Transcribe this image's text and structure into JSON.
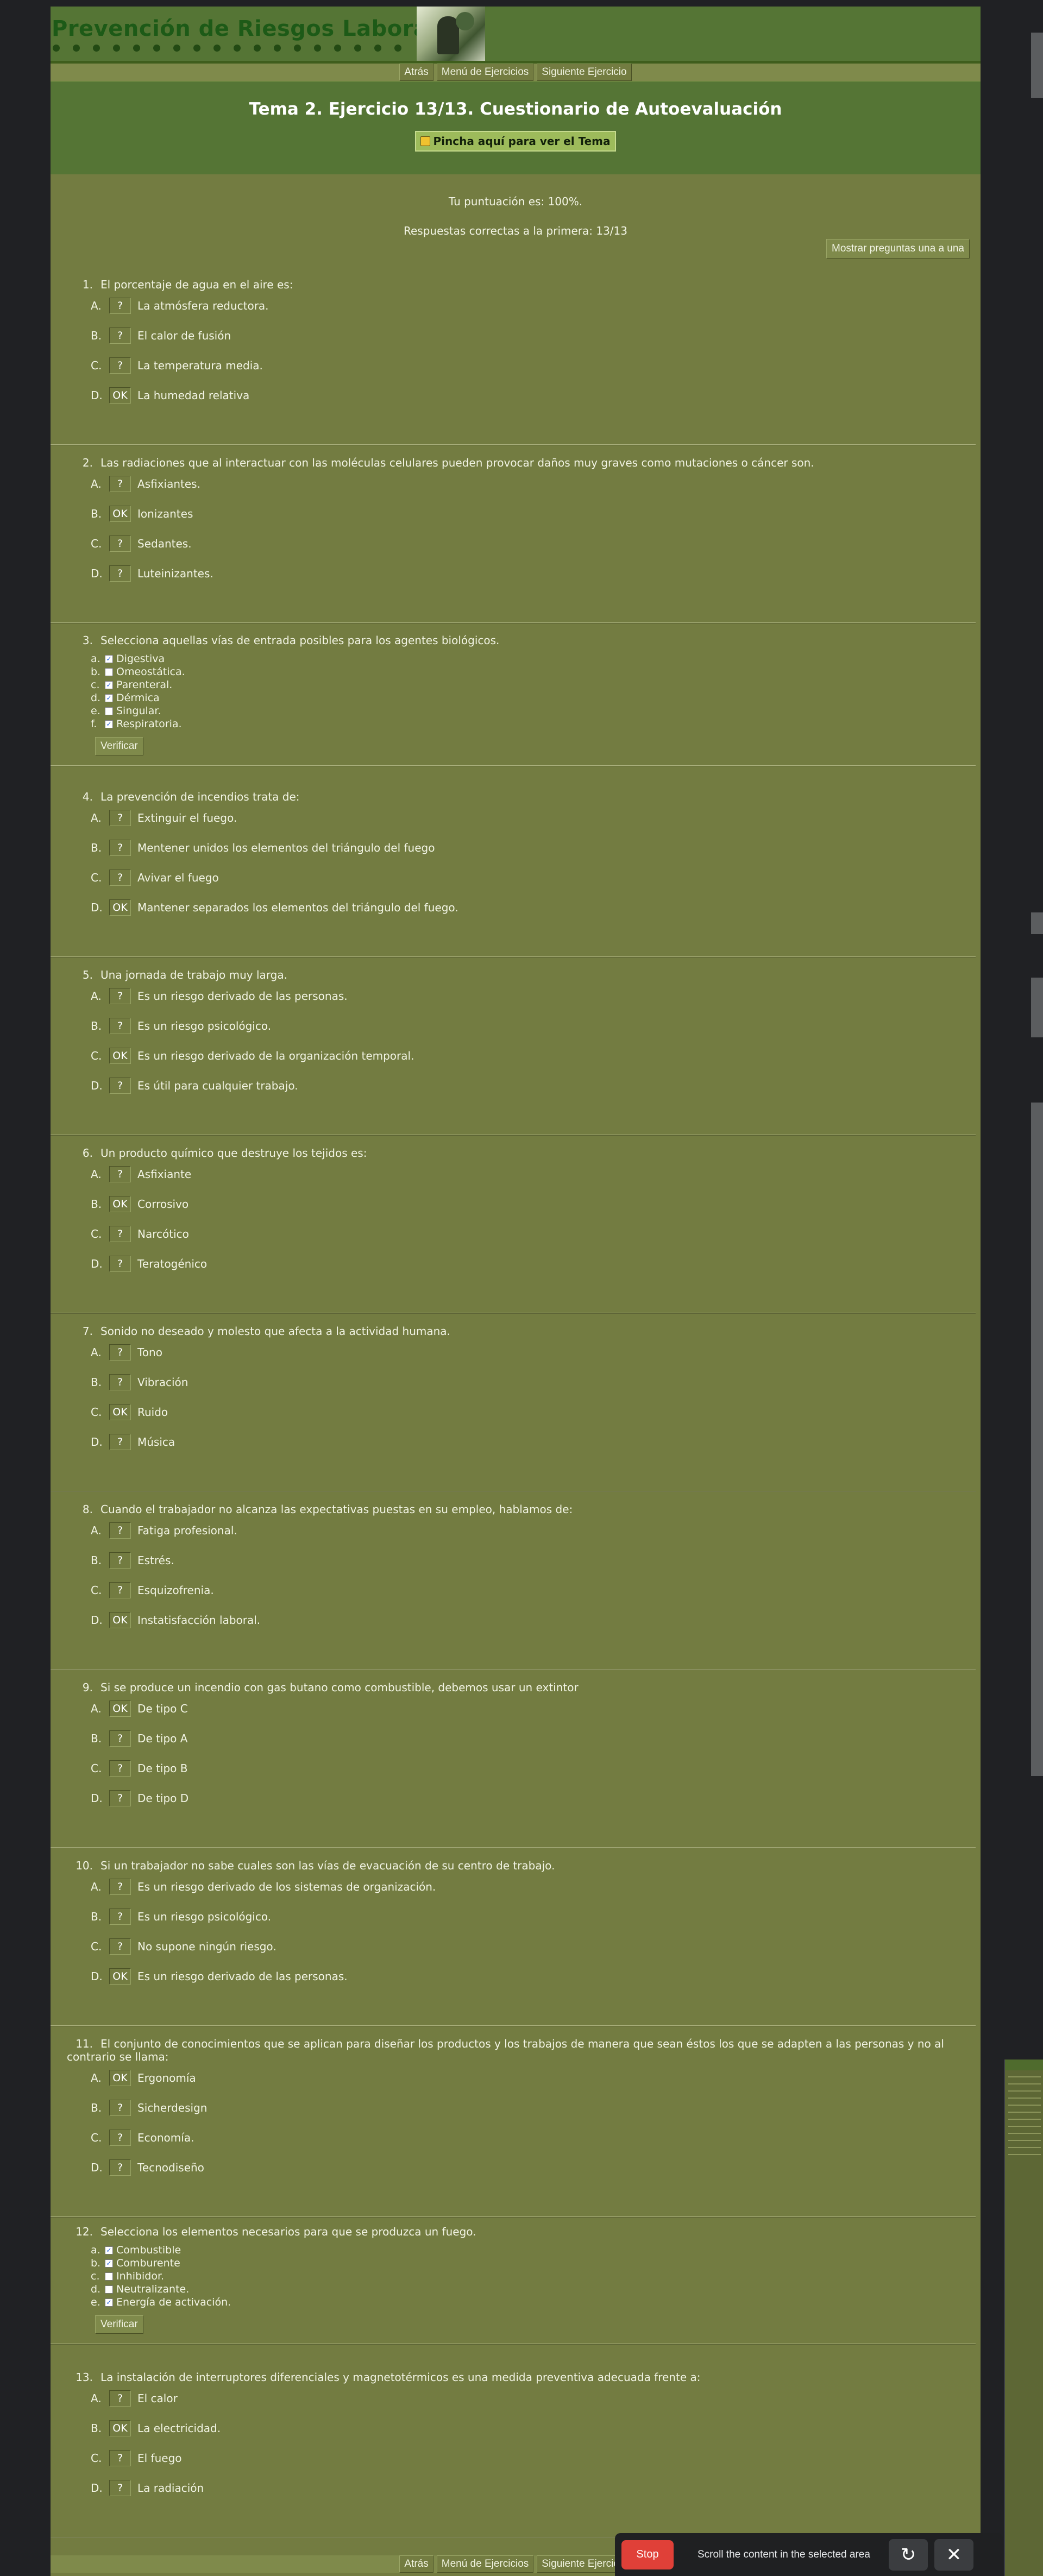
{
  "header": {
    "logo_text": "Prevención de Riesgos Laborales",
    "nav": [
      "Atrás",
      "Menú de Ejercicios",
      "Siguiente Ejercicio"
    ]
  },
  "exercise": {
    "title": "Tema 2. Ejercicio 13/13. Cuestionario de Autoevaluación",
    "theme_link": "Pincha aquí para ver el Tema",
    "score": "Tu puntuación es: 100%.",
    "first_try": "Respuestas correctas a la primera: 13/13",
    "show_one_button": "Mostrar preguntas una a una"
  },
  "questions": [
    {
      "num": "1.",
      "text": "El porcentaje de agua en el aire es:",
      "options": [
        {
          "letter": "A.",
          "mark": "?",
          "text": "La atmósfera reductora."
        },
        {
          "letter": "B.",
          "mark": "?",
          "text": "El calor de fusión"
        },
        {
          "letter": "C.",
          "mark": "?",
          "text": "La temperatura media."
        },
        {
          "letter": "D.",
          "mark": "OK",
          "text": "La humedad relativa"
        }
      ]
    },
    {
      "num": "2.",
      "text": "Las radiaciones que al interactuar con las moléculas celulares pueden provocar daños muy graves como mutaciones o cáncer son.",
      "options": [
        {
          "letter": "A.",
          "mark": "?",
          "text": "Asfixiantes."
        },
        {
          "letter": "B.",
          "mark": "OK",
          "text": "Ionizantes"
        },
        {
          "letter": "C.",
          "mark": "?",
          "text": "Sedantes."
        },
        {
          "letter": "D.",
          "mark": "?",
          "text": "Luteinizantes."
        }
      ]
    },
    {
      "num": "3.",
      "text": "Selecciona aquellas vías de entrada posibles para los agentes biológicos.",
      "checks": [
        {
          "letter": "a.",
          "checked": true,
          "text": "Digestiva"
        },
        {
          "letter": "b.",
          "checked": false,
          "text": "Omeostática."
        },
        {
          "letter": "c.",
          "checked": true,
          "text": "Parenteral."
        },
        {
          "letter": "d.",
          "checked": true,
          "text": "Dérmica"
        },
        {
          "letter": "e.",
          "checked": false,
          "text": "Singular."
        },
        {
          "letter": "f.",
          "checked": true,
          "text": "Respiratoria."
        }
      ],
      "verify": "Verificar"
    },
    {
      "num": "4.",
      "text": "La prevención de incendios trata de:",
      "options": [
        {
          "letter": "A.",
          "mark": "?",
          "text": "Extinguir el fuego."
        },
        {
          "letter": "B.",
          "mark": "?",
          "text": "Mentener unidos los elementos del triángulo del fuego"
        },
        {
          "letter": "C.",
          "mark": "?",
          "text": "Avivar el fuego"
        },
        {
          "letter": "D.",
          "mark": "OK",
          "text": "Mantener separados los elementos del triángulo del fuego."
        }
      ]
    },
    {
      "num": "5.",
      "text": "Una jornada de trabajo muy larga.",
      "options": [
        {
          "letter": "A.",
          "mark": "?",
          "text": "Es un riesgo derivado de las personas."
        },
        {
          "letter": "B.",
          "mark": "?",
          "text": "Es un riesgo psicológico."
        },
        {
          "letter": "C.",
          "mark": "OK",
          "text": "Es un riesgo derivado de la organización temporal."
        },
        {
          "letter": "D.",
          "mark": "?",
          "text": "Es útil para cualquier trabajo."
        }
      ]
    },
    {
      "num": "6.",
      "text": "Un producto químico que destruye los tejidos es:",
      "options": [
        {
          "letter": "A.",
          "mark": "?",
          "text": "Asfixiante"
        },
        {
          "letter": "B.",
          "mark": "OK",
          "text": "Corrosivo"
        },
        {
          "letter": "C.",
          "mark": "?",
          "text": "Narcótico"
        },
        {
          "letter": "D.",
          "mark": "?",
          "text": "Teratogénico"
        }
      ]
    },
    {
      "num": "7.",
      "text": "Sonido no deseado y molesto que afecta a la actividad humana.",
      "options": [
        {
          "letter": "A.",
          "mark": "?",
          "text": "Tono"
        },
        {
          "letter": "B.",
          "mark": "?",
          "text": "Vibración"
        },
        {
          "letter": "C.",
          "mark": "OK",
          "text": "Ruido"
        },
        {
          "letter": "D.",
          "mark": "?",
          "text": "Música"
        }
      ]
    },
    {
      "num": "8.",
      "text": "Cuando el trabajador no alcanza las expectativas puestas en su empleo, hablamos de:",
      "options": [
        {
          "letter": "A.",
          "mark": "?",
          "text": "Fatiga profesional."
        },
        {
          "letter": "B.",
          "mark": "?",
          "text": "Estrés."
        },
        {
          "letter": "C.",
          "mark": "?",
          "text": "Esquizofrenia."
        },
        {
          "letter": "D.",
          "mark": "OK",
          "text": "Instatisfacción laboral."
        }
      ]
    },
    {
      "num": "9.",
      "text": "Si se produce un incendio con gas butano como combustible, debemos usar un extintor",
      "options": [
        {
          "letter": "A.",
          "mark": "OK",
          "text": "De tipo C"
        },
        {
          "letter": "B.",
          "mark": "?",
          "text": "De tipo A"
        },
        {
          "letter": "C.",
          "mark": "?",
          "text": "De tipo B"
        },
        {
          "letter": "D.",
          "mark": "?",
          "text": "De tipo D"
        }
      ]
    },
    {
      "num": "10.",
      "text": "Si un trabajador no sabe cuales son las vías de evacuación de su centro de trabajo.",
      "options": [
        {
          "letter": "A.",
          "mark": "?",
          "text": "Es un riesgo derivado de los sistemas de organización."
        },
        {
          "letter": "B.",
          "mark": "?",
          "text": "Es un riesgo psicológico."
        },
        {
          "letter": "C.",
          "mark": "?",
          "text": "No supone ningún riesgo."
        },
        {
          "letter": "D.",
          "mark": "OK",
          "text": "Es un riesgo derivado de las personas."
        }
      ]
    },
    {
      "num": "11.",
      "text": "El conjunto de conocimientos que se aplican para diseñar los productos y los trabajos de manera que sean éstos los que se adapten a las personas y no al contrario se llama:",
      "options": [
        {
          "letter": "A.",
          "mark": "OK",
          "text": "Ergonomía"
        },
        {
          "letter": "B.",
          "mark": "?",
          "text": "Sicherdesign"
        },
        {
          "letter": "C.",
          "mark": "?",
          "text": "Economía."
        },
        {
          "letter": "D.",
          "mark": "?",
          "text": "Tecnodiseño"
        }
      ]
    },
    {
      "num": "12.",
      "text": "Selecciona los elementos necesarios para que se produzca un fuego.",
      "checks": [
        {
          "letter": "a.",
          "checked": true,
          "text": "Combustible"
        },
        {
          "letter": "b.",
          "checked": true,
          "text": "Comburente"
        },
        {
          "letter": "c.",
          "checked": false,
          "text": "Inhibidor."
        },
        {
          "letter": "d.",
          "checked": false,
          "text": "Neutralizante."
        },
        {
          "letter": "e.",
          "checked": true,
          "text": "Energía de activación."
        }
      ],
      "verify": "Verificar"
    },
    {
      "num": "13.",
      "text": "La instalación de interruptores diferenciales y magnetotérmicos es una medida preventiva adecuada frente a:",
      "options": [
        {
          "letter": "A.",
          "mark": "?",
          "text": "El calor"
        },
        {
          "letter": "B.",
          "mark": "OK",
          "text": "La electricidad."
        },
        {
          "letter": "C.",
          "mark": "?",
          "text": "El fuego"
        },
        {
          "letter": "D.",
          "mark": "?",
          "text": "La radiación"
        }
      ]
    }
  ],
  "agent_toolbar": {
    "stop": "Stop",
    "status": "Scroll the content in the selected area",
    "icons": [
      "refresh-icon",
      "close-icon"
    ]
  }
}
